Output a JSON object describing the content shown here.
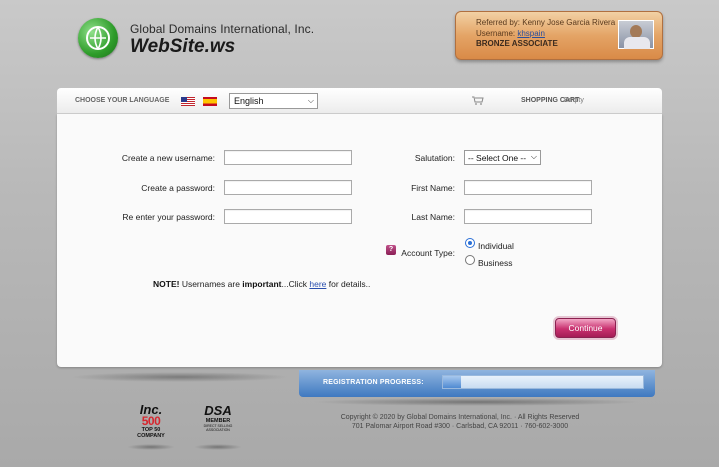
{
  "header": {
    "company": "Global Domains International, Inc.",
    "brand": "WebSite.ws"
  },
  "referral": {
    "referred_by": "Referred by: Kenny Jose Garcia Rivera",
    "username_label": "Username: ",
    "username": "khspain",
    "rank": "BRONZE ASSOCIATE"
  },
  "topbar": {
    "language_label": "CHOOSE YOUR LANGUAGE",
    "language_selected": "English",
    "cart_label": "SHOPPING CART",
    "cart_status": "Empty"
  },
  "form": {
    "username_label": "Create a new username:",
    "password_label": "Create a password:",
    "reenter_label": "Re enter your password:",
    "salutation_label": "Salutation:",
    "salutation_selected": "-- Select One --",
    "first_name_label": "First Name:",
    "last_name_label": "Last Name:",
    "account_type_label": "Account Type:",
    "account_types": [
      "Individual",
      "Business"
    ],
    "account_type_selected": "Individual"
  },
  "note": {
    "prefix": "NOTE!",
    "text1": " Usernames are ",
    "emphasis": "important",
    "text2": "...Click ",
    "link": "here",
    "text3": " for details.."
  },
  "actions": {
    "continue_label": "Continue"
  },
  "progress": {
    "label": "REGISTRATION PROGRESS:",
    "fraction": 0.09
  },
  "badges": {
    "inc_title": "Inc.",
    "inc_number": "500",
    "inc_caption1": "TOP 50",
    "inc_caption2": "COMPANY",
    "dsa_title": "DSA",
    "dsa_caption": "MEMBER",
    "dsa_tiny": "DIRECT SELLING ASSOCIATION"
  },
  "footer": {
    "line1": "Copyright © 2020 by Global Domains International, Inc. · All Rights Reserved",
    "line2": "701 Palomar Airport Road #300 · Carlsbad, CA 92011 · 760-602-3000"
  },
  "colors": {
    "accent": "#c9306f",
    "progress": "#4f8ad2",
    "logo_green": "#2e9c2a"
  }
}
